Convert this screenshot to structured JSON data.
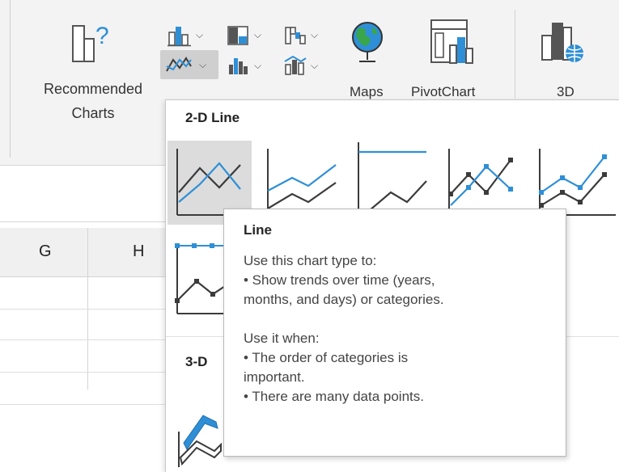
{
  "ribbon": {
    "recommended_label_1": "Recommended",
    "recommended_label_2": "Charts",
    "maps_label": "Maps",
    "pivotchart_label": "PivotChart",
    "threed_label": "3D"
  },
  "columns": [
    "G",
    "H"
  ],
  "dropdown": {
    "section_2d": "2-D Line",
    "section_3d": "3-D",
    "selected_thumbnail": "Line"
  },
  "tooltip": {
    "title": "Line",
    "lines_a": [
      "Use this chart type to:",
      "• Show trends over time (years,",
      "months, and days) or categories."
    ],
    "lines_b": [
      "Use it when:",
      "• The order of categories is",
      "important.",
      "• There are many data points."
    ]
  },
  "colors": {
    "accent_blue": "#2e8fd6",
    "dark_line": "#3b3b3b",
    "selection_gray": "#dcdcdc"
  }
}
